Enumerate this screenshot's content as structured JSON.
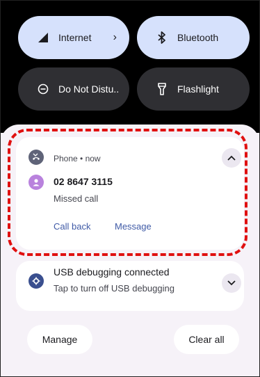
{
  "quick_settings": {
    "internet": {
      "label": "Internet",
      "icon": "signal-icon",
      "chevron": "›"
    },
    "bluetooth": {
      "label": "Bluetooth",
      "icon": "bluetooth-icon"
    },
    "dnd": {
      "label": "Do Not Distu..",
      "icon": "do-not-disturb-icon"
    },
    "flashlight": {
      "label": "Flashlight",
      "icon": "flashlight-icon"
    }
  },
  "notifications": [
    {
      "app": "Phone • now",
      "app_icon": "missed-call-icon",
      "avatar_icon": "person-icon",
      "title": "02 8647 3115",
      "text": "Missed call",
      "actions": [
        "Call back",
        "Message"
      ],
      "expand_icon": "chevron-up-icon"
    },
    {
      "icon": "usb-debug-icon",
      "title": "USB debugging connected",
      "text": "Tap to turn off USB debugging",
      "expand_icon": "chevron-down-icon"
    }
  ],
  "footer": {
    "manage": "Manage",
    "clear_all": "Clear all"
  },
  "colors": {
    "tile_on": "#d6e1fc",
    "tile_off": "#2f2f33",
    "accent": "#3f5aa6",
    "avatar": "#b982dd",
    "usb_icon": "#3a4f8f",
    "highlight": "#e01010"
  }
}
